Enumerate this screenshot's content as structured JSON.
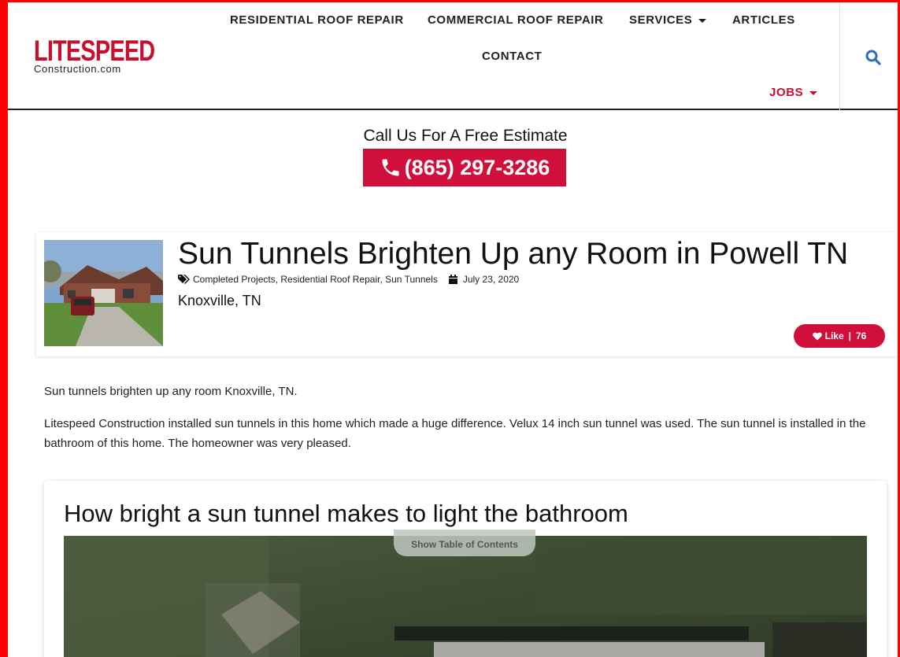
{
  "logo": {
    "main": "LITESPEED",
    "sub": "Construction.com"
  },
  "nav": {
    "residential": "RESIDENTIAL ROOF REPAIR",
    "commercial": "COMMERCIAL ROOF REPAIR",
    "services": "SERVICES",
    "articles": "ARTICLES",
    "contact": "CONTACT",
    "jobs": "JOBS"
  },
  "call": {
    "text": "Call Us For A Free Estimate",
    "phone": "(865) 297-3286"
  },
  "post": {
    "title": "Sun Tunnels Brighten Up any Room in Powell TN",
    "categories": "Completed Projects, Residential Roof Repair, Sun Tunnels",
    "date": "July 23, 2020",
    "location": "Knoxville,  TN",
    "like_label": "Like",
    "like_sep": "|",
    "like_count": "76"
  },
  "body": {
    "intro": "Sun tunnels brighten up any room Knoxville, TN.",
    "paragraph": "Litespeed Construction installed sun tunnels in this home which made a huge difference.  Velux 14 inch sun tunnel was used.  The sun tunnel is installed in the bathroom of this home.  The homeowner was very pleased."
  },
  "section": {
    "title": "How bright a sun tunnel makes to light the bathroom",
    "toc": "Show Table of Contents"
  },
  "colors": {
    "brand_red": "#c8102e",
    "button_red": "#d0103a",
    "frame": "#ff0000",
    "search_blue": "#2c6fb7"
  }
}
